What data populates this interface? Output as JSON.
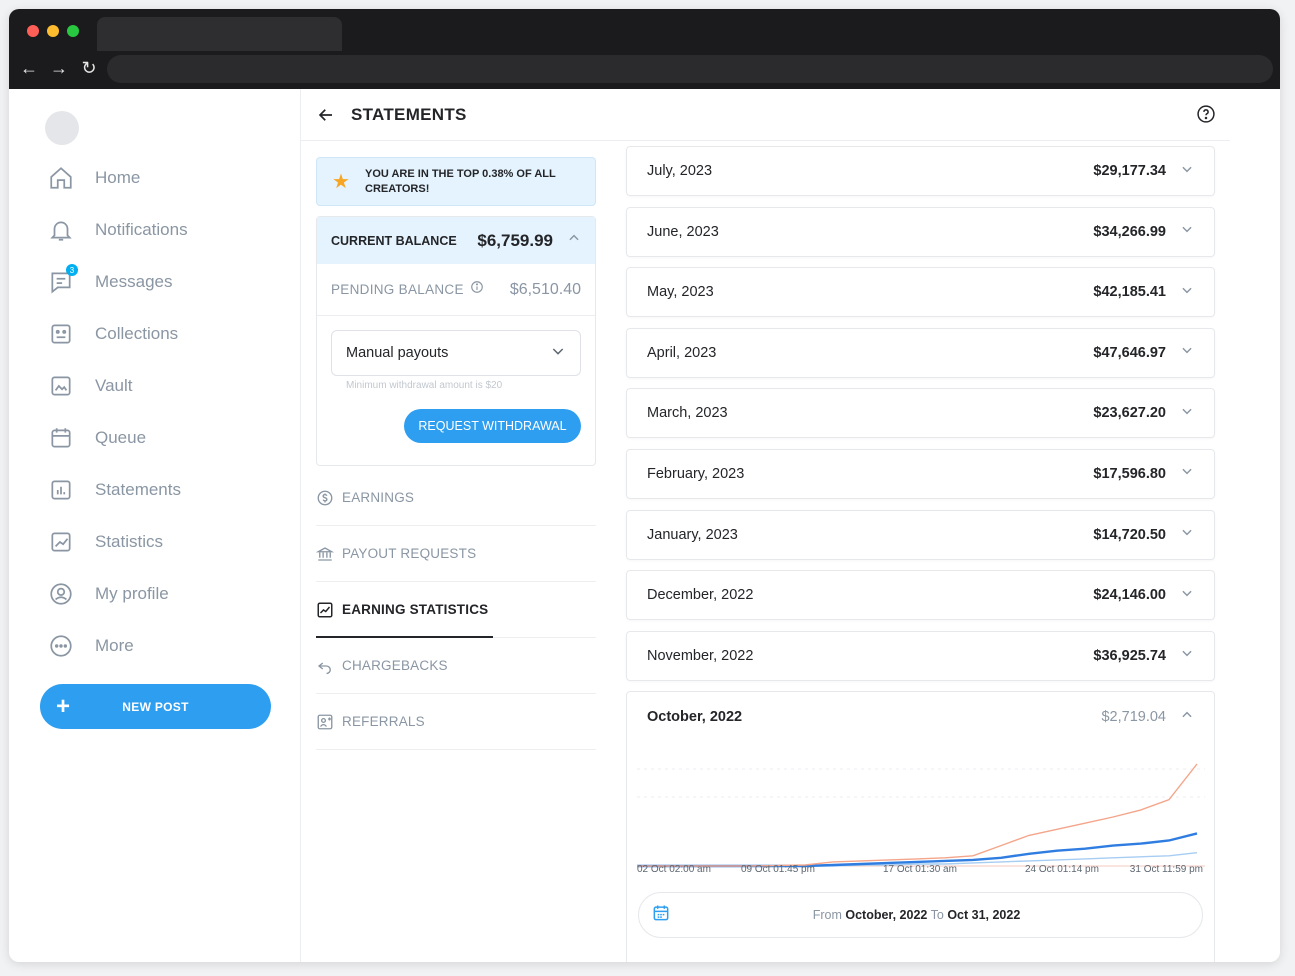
{
  "colors": {
    "accent": "#2e9ef0",
    "star": "#f7a623",
    "chart_blue": "#2f7de1",
    "chart_orange": "#f4a58a",
    "chart_lightblue": "#a7cdf2"
  },
  "sidebar": {
    "messages_badge": "3",
    "items": [
      {
        "label": "Home",
        "icon": "home-icon"
      },
      {
        "label": "Notifications",
        "icon": "bell-icon"
      },
      {
        "label": "Messages",
        "icon": "message-icon"
      },
      {
        "label": "Collections",
        "icon": "collections-icon"
      },
      {
        "label": "Vault",
        "icon": "vault-icon"
      },
      {
        "label": "Queue",
        "icon": "calendar-icon"
      },
      {
        "label": "Statements",
        "icon": "statements-icon"
      },
      {
        "label": "Statistics",
        "icon": "statistics-icon"
      },
      {
        "label": "My profile",
        "icon": "profile-icon"
      },
      {
        "label": "More",
        "icon": "more-icon"
      }
    ],
    "new_post": "NEW POST"
  },
  "header": {
    "title": "STATEMENTS"
  },
  "banner": {
    "text": "YOU ARE IN THE TOP 0.38% OF ALL CREATORS!"
  },
  "balance": {
    "current_label": "CURRENT BALANCE",
    "current_value": "$6,759.99",
    "pending_label": "PENDING BALANCE",
    "pending_value": "$6,510.40",
    "payout_mode": "Manual payouts",
    "hint": "Minimum withdrawal amount is $20",
    "withdraw_label": "REQUEST WITHDRAWAL"
  },
  "menu": [
    {
      "label": "EARNINGS",
      "icon": "dollar-icon"
    },
    {
      "label": "PAYOUT REQUESTS",
      "icon": "bank-icon"
    },
    {
      "label": "EARNING STATISTICS",
      "icon": "chart-icon",
      "active": true
    },
    {
      "label": "CHARGEBACKS",
      "icon": "undo-icon"
    },
    {
      "label": "REFERRALS",
      "icon": "referral-icon"
    }
  ],
  "months": [
    {
      "month": "July, 2023",
      "amount": "$29,177.34"
    },
    {
      "month": "June, 2023",
      "amount": "$34,266.99"
    },
    {
      "month": "May, 2023",
      "amount": "$42,185.41"
    },
    {
      "month": "April, 2023",
      "amount": "$47,646.97"
    },
    {
      "month": "March, 2023",
      "amount": "$23,627.20"
    },
    {
      "month": "February, 2023",
      "amount": "$17,596.80"
    },
    {
      "month": "January, 2023",
      "amount": "$14,720.50"
    },
    {
      "month": "December, 2022",
      "amount": "$24,146.00"
    },
    {
      "month": "November, 2022",
      "amount": "$36,925.74"
    }
  ],
  "expanded": {
    "month": "October, 2022",
    "amount": "$2,719.04",
    "range_from_label": "From",
    "range_from": "October, 2022",
    "range_to_label": "To",
    "range_to": "Oct 31, 2022"
  },
  "chart_data": {
    "type": "line",
    "x_ticks": [
      "02 Oct 02:00 am",
      "09 Oct 01:45 pm",
      "17 Oct 01:30 am",
      "24 Oct 01:14 pm",
      "31 Oct 11:59 pm"
    ],
    "x": [
      0,
      0.1,
      0.2,
      0.3,
      0.35,
      0.4,
      0.45,
      0.5,
      0.55,
      0.6,
      0.65,
      0.7,
      0.75,
      0.8,
      0.85,
      0.9,
      0.95,
      1.0
    ],
    "series": [
      {
        "color": "orange",
        "values": [
          0,
          0,
          0,
          0.01,
          0.04,
          0.05,
          0.06,
          0.07,
          0.08,
          0.1,
          0.2,
          0.3,
          0.36,
          0.42,
          0.48,
          0.55,
          0.65,
          1.0
        ]
      },
      {
        "color": "blue",
        "values": [
          0,
          0,
          0,
          0,
          0.01,
          0.02,
          0.03,
          0.04,
          0.05,
          0.06,
          0.08,
          0.12,
          0.15,
          0.17,
          0.2,
          0.22,
          0.25,
          0.32
        ]
      },
      {
        "color": "lightblue",
        "values": [
          0,
          0,
          0,
          0,
          0,
          0.01,
          0.01,
          0.02,
          0.02,
          0.03,
          0.04,
          0.05,
          0.06,
          0.07,
          0.08,
          0.09,
          0.1,
          0.13
        ]
      }
    ],
    "grid": true
  }
}
